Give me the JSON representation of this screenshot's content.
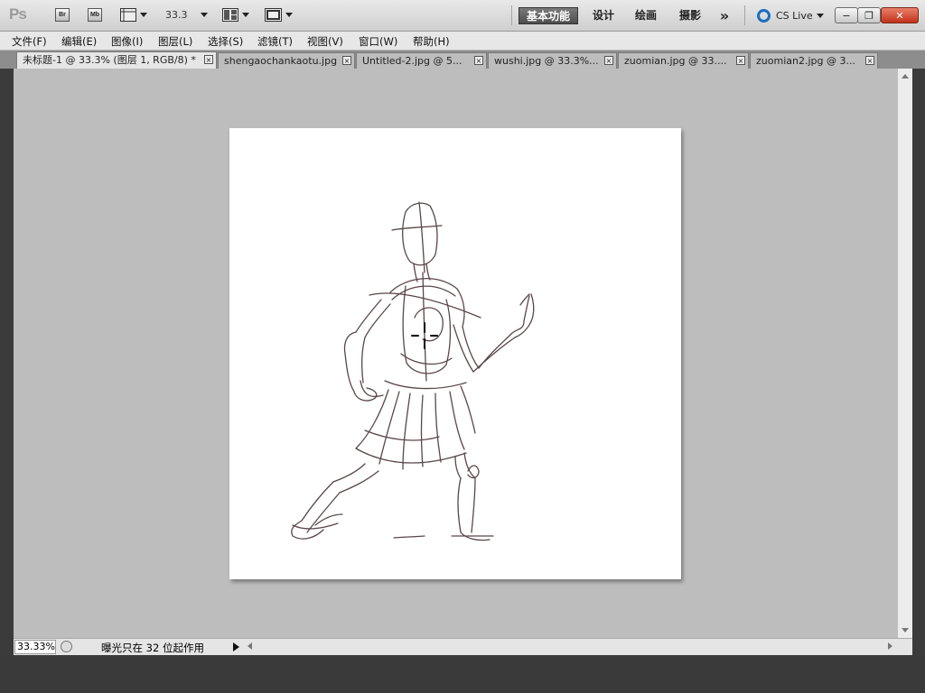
{
  "app": {
    "logo": "Ps",
    "bridge_label": "Br",
    "minibridge_label": "Mb",
    "zoom_value": "33.3",
    "workspaces": [
      "基本功能",
      "设计",
      "绘画",
      "摄影"
    ],
    "more_symbol": "»",
    "cs_live": "CS Live"
  },
  "window_controls": {
    "minimize": "−",
    "restore": "❐",
    "close": "✕"
  },
  "menu": [
    "文件(F)",
    "编辑(E)",
    "图像(I)",
    "图层(L)",
    "选择(S)",
    "滤镜(T)",
    "视图(V)",
    "窗口(W)",
    "帮助(H)"
  ],
  "tabs": [
    {
      "label": "未标题-1 @ 33.3% (图层 1, RGB/8) *",
      "active": true
    },
    {
      "label": "shengaochankaotu.jpg",
      "active": false
    },
    {
      "label": "Untitled-2.jpg @ 5...",
      "active": false
    },
    {
      "label": "wushi.jpg @ 33.3%...",
      "active": false
    },
    {
      "label": "zuomian.jpg @ 33....",
      "active": false
    },
    {
      "label": "zuomian2.jpg @ 3...",
      "active": false
    }
  ],
  "tab_close_symbol": "×",
  "status": {
    "zoom": "33.33%",
    "message": "曝光只在 32 位起作用"
  },
  "colors": {
    "canvas": "#ffffff",
    "workspace_bg": "#bdbdbd",
    "stroke": "#5a4648",
    "active_workspace": "#5a5a5a",
    "close_button": "#c9472e",
    "cs_live_ring": "#1b6dc1"
  },
  "icons": {
    "bridge": "bridge-icon",
    "minibridge": "mini-bridge-icon",
    "view_extras": "view-extras-icon",
    "arrange": "arrange-documents-icon",
    "screen_mode": "screen-mode-icon",
    "brush_cursor": "crosshair-icon"
  }
}
